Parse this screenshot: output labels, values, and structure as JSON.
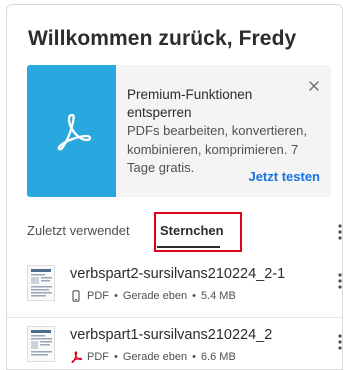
{
  "header": {
    "welcome": "Willkommen zurück, Fredy"
  },
  "promo": {
    "title": "Premium-Funktionen entsperren",
    "description": "PDFs bearbeiten, konvertieren, kombinieren, komprimieren. 7 Tage gratis.",
    "cta_label": "Jetzt testen",
    "tile_color": "#29a8e0",
    "icon": "acrobat-icon"
  },
  "tabs": {
    "recent_label": "Zuletzt verwendet",
    "starred_label": "Sternchen",
    "selected": "Sternchen",
    "highlight_color": "#e0001b"
  },
  "files": [
    {
      "name": "verbspart2-sursilvans210224_2-1",
      "type": "PDF",
      "separator": "•",
      "time": "Gerade eben",
      "size": "5.4 MB",
      "type_icon": "phone-icon"
    },
    {
      "name": "verbspart1-sursilvans210224_2",
      "type": "PDF",
      "separator": "•",
      "time": "Gerade eben",
      "size": "6.6 MB",
      "type_icon": "acrobat-icon"
    }
  ],
  "colors": {
    "accent": "#1473e6",
    "acrobat_red": "#e0001b"
  }
}
